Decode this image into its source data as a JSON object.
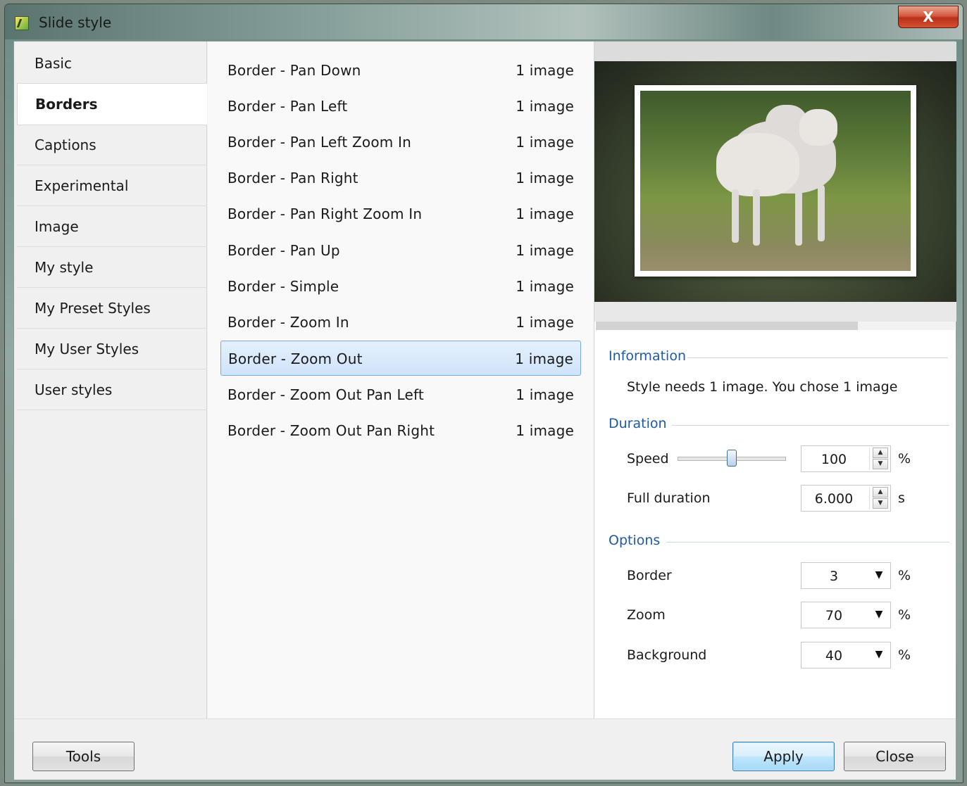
{
  "window": {
    "title": "Slide style",
    "close_glyph": "X"
  },
  "tabs": [
    {
      "label": "Basic",
      "active": false
    },
    {
      "label": "Borders",
      "active": true
    },
    {
      "label": "Captions",
      "active": false
    },
    {
      "label": "Experimental",
      "active": false
    },
    {
      "label": "Image",
      "active": false
    },
    {
      "label": "My style",
      "active": false
    },
    {
      "label": "My Preset Styles",
      "active": false
    },
    {
      "label": "My User Styles",
      "active": false
    },
    {
      "label": "User styles",
      "active": false
    }
  ],
  "styles": [
    {
      "name": "Border - Pan Down",
      "count": "1 image"
    },
    {
      "name": "Border - Pan Left",
      "count": "1 image"
    },
    {
      "name": "Border - Pan Left Zoom In",
      "count": "1 image"
    },
    {
      "name": "Border - Pan Right",
      "count": "1 image"
    },
    {
      "name": "Border - Pan Right Zoom In",
      "count": "1 image"
    },
    {
      "name": "Border - Pan Up",
      "count": "1 image"
    },
    {
      "name": "Border - Simple",
      "count": "1 image"
    },
    {
      "name": "Border - Zoom In",
      "count": "1 image"
    },
    {
      "name": "Border - Zoom Out",
      "count": "1 image",
      "selected": true
    },
    {
      "name": "Border - Zoom Out Pan Left",
      "count": "1 image"
    },
    {
      "name": "Border - Zoom Out Pan Right",
      "count": "1 image"
    }
  ],
  "preview": {
    "playback_progress": 0.73
  },
  "information": {
    "title": "Information",
    "text": "Style needs 1 image. You chose 1 image"
  },
  "duration": {
    "title": "Duration",
    "speed_label": "Speed",
    "speed_value": "100",
    "speed_unit": "%",
    "speed_slider_fraction": 0.5,
    "full_duration_label": "Full duration",
    "full_duration_value": "6.000",
    "full_duration_unit": "s"
  },
  "options": {
    "title": "Options",
    "border_label": "Border",
    "border_value": "3",
    "border_unit": "%",
    "zoom_label": "Zoom",
    "zoom_value": "70",
    "zoom_unit": "%",
    "background_label": "Background",
    "background_value": "40",
    "background_unit": "%"
  },
  "buttons": {
    "tools": "Tools",
    "apply": "Apply",
    "close": "Close"
  },
  "colors": {
    "accent": "#1e5aa8",
    "selection": "#cfe4fa",
    "close_button": "#c8401f"
  }
}
